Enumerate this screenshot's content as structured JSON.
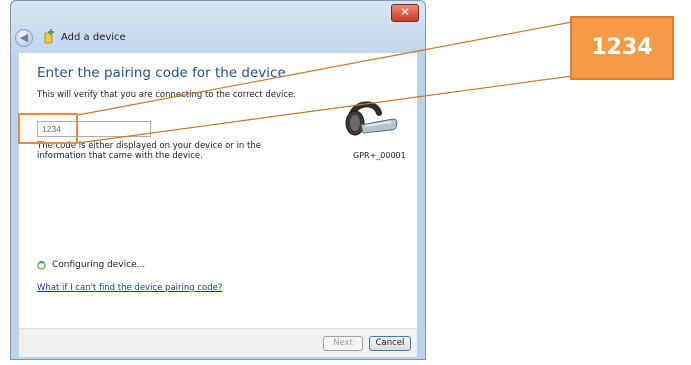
{
  "window": {
    "title": "Add a device",
    "close_glyph": "✕",
    "back_glyph": "◀"
  },
  "content": {
    "heading": "Enter the pairing code for the device",
    "subtext": "This will verify that you are connecting to the correct device.",
    "code_input_value": "1234",
    "hint": "The code is either displayed on your device or in the information that came with the device.",
    "device_name": "GPR+_00001",
    "status": "Configuring device...",
    "help_link": "What if I can't find the device pairing code?"
  },
  "footer": {
    "next_label": "Next",
    "cancel_label": "Cancel"
  },
  "callout": {
    "text": "1234"
  },
  "colors": {
    "accent_orange": "#f59a47",
    "heading_blue": "#1f4f99",
    "link_blue": "#0f3fa8"
  },
  "icons": [
    "back-arrow-icon",
    "add-device-icon",
    "close-icon",
    "headset-device-icon",
    "progress-spinner-icon"
  ]
}
